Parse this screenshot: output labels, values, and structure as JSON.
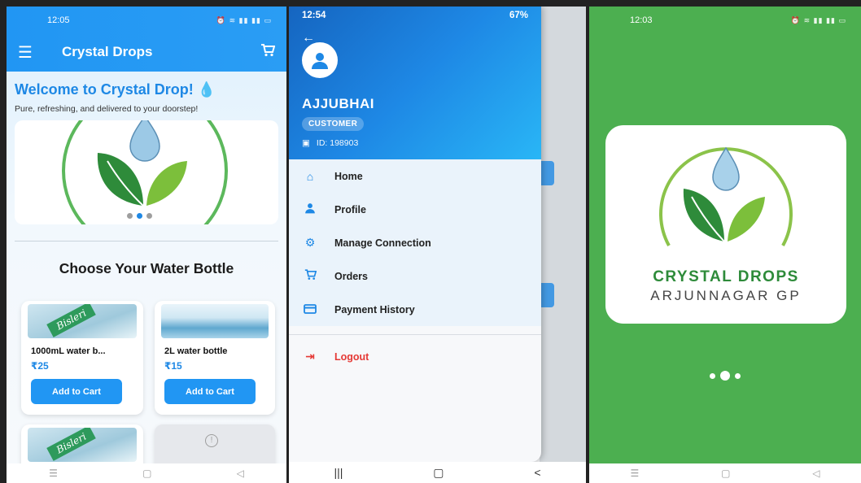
{
  "screen1": {
    "status_time": "12:05",
    "app_title": "Crystal Drops",
    "welcome": "Welcome to Crystal Drop! 💧",
    "tagline": "Pure, refreshing, and delivered to your doorstep!",
    "section_title": "Choose Your Water Bottle",
    "products": [
      {
        "name": "1000mL water b...",
        "price": "₹25",
        "button": "Add to Cart",
        "brand_label": "Bisleri"
      },
      {
        "name": "2L water bottle",
        "price": "₹15",
        "button": "Add to Cart"
      }
    ],
    "next_product_label": "Bisleri",
    "nav": {
      "recent": "☰",
      "home": "▢",
      "back": "◁"
    }
  },
  "screen2": {
    "status_time": "12:54",
    "status_battery": "67%",
    "user_name": "AJJUBHAI",
    "role": "CUSTOMER",
    "user_id": "ID: 198903",
    "menu": [
      {
        "label": "Home",
        "icon": "home-icon"
      },
      {
        "label": "Profile",
        "icon": "person-icon"
      },
      {
        "label": "Manage Connection",
        "icon": "gear-icon"
      },
      {
        "label": "Orders",
        "icon": "cart-icon"
      },
      {
        "label": "Payment History",
        "icon": "card-icon"
      }
    ],
    "logout": "Logout",
    "nav": {
      "recent": "|||",
      "home": "▢",
      "back": "<"
    }
  },
  "screen3": {
    "status_time": "12:03",
    "brand_line1": "CRYSTAL DROPS",
    "brand_line2": "ARJUNNAGAR GP",
    "nav": {
      "recent": "☰",
      "home": "▢",
      "back": "◁"
    }
  },
  "colors": {
    "primary": "#2196f3",
    "splash_green": "#4caf50",
    "logout_red": "#e53935"
  }
}
